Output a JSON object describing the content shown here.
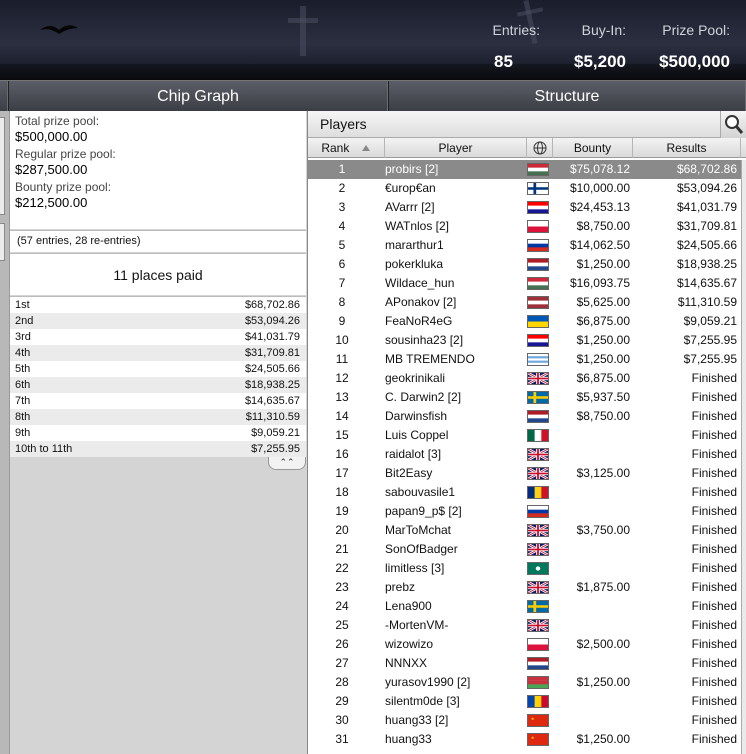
{
  "header": {
    "entries_label": "Entries:",
    "entries_value": "85",
    "buyin_label": "Buy-In:",
    "buyin_value": "$5,200",
    "prizepool_label": "Prize Pool:",
    "prizepool_value": "$500,000"
  },
  "tabs": [
    {
      "label": "Chip Graph"
    },
    {
      "label": "Structure"
    }
  ],
  "prize_info": {
    "total_label": "Total prize pool:",
    "total_value": "$500,000.00",
    "regular_label": "Regular prize pool:",
    "regular_value": "$287,500.00",
    "bounty_label": "Bounty prize pool:",
    "bounty_value": "$212,500.00",
    "entries_note": "(57 entries, 28 re-entries)",
    "places_paid": "11 places paid"
  },
  "payouts": [
    {
      "place": "1st",
      "amount": "$68,702.86"
    },
    {
      "place": "2nd",
      "amount": "$53,094.26"
    },
    {
      "place": "3rd",
      "amount": "$41,031.79"
    },
    {
      "place": "4th",
      "amount": "$31,709.81"
    },
    {
      "place": "5th",
      "amount": "$24,505.66"
    },
    {
      "place": "6th",
      "amount": "$18,938.25"
    },
    {
      "place": "7th",
      "amount": "$14,635.67"
    },
    {
      "place": "8th",
      "amount": "$11,310.59"
    },
    {
      "place": "9th",
      "amount": "$9,059.21"
    },
    {
      "place": "10th to 11th",
      "amount": "$7,255.95"
    }
  ],
  "players_panel": {
    "title": "Players",
    "columns": {
      "rank": "Rank",
      "player": "Player",
      "bounty": "Bounty",
      "results": "Results"
    },
    "selected_row": 0,
    "rows": [
      {
        "rank": "1",
        "name": "probirs [2]",
        "flag": "hungary",
        "bounty": "$75,078.12",
        "result": "$68,702.86"
      },
      {
        "rank": "2",
        "name": "€urop€an",
        "flag": "finland",
        "bounty": "$10,000.00",
        "result": "$53,094.26"
      },
      {
        "rank": "3",
        "name": "AVarrr [2]",
        "flag": "croatia",
        "bounty": "$24,453.13",
        "result": "$41,031.79"
      },
      {
        "rank": "4",
        "name": "WATnlos [2]",
        "flag": "poland",
        "bounty": "$8,750.00",
        "result": "$31,709.81"
      },
      {
        "rank": "5",
        "name": "mararthur1",
        "flag": "russia",
        "bounty": "$14,062.50",
        "result": "$24,505.66"
      },
      {
        "rank": "6",
        "name": "pokerkluka",
        "flag": "netherlands",
        "bounty": "$1,250.00",
        "result": "$18,938.25"
      },
      {
        "rank": "7",
        "name": "Wildace_hun",
        "flag": "hungary",
        "bounty": "$16,093.75",
        "result": "$14,635.67"
      },
      {
        "rank": "8",
        "name": "APonakov [2]",
        "flag": "latvia",
        "bounty": "$5,625.00",
        "result": "$11,310.59"
      },
      {
        "rank": "9",
        "name": "FeaNoR4eG",
        "flag": "ukraine",
        "bounty": "$6,875.00",
        "result": "$9,059.21"
      },
      {
        "rank": "10",
        "name": "sousinha23 [2]",
        "flag": "croatia",
        "bounty": "$1,250.00",
        "result": "$7,255.95"
      },
      {
        "rank": "11",
        "name": "MB TREMENDO",
        "flag": "uruguay",
        "bounty": "$1,250.00",
        "result": "$7,255.95"
      },
      {
        "rank": "12",
        "name": "geokrinikali",
        "flag": "uk",
        "bounty": "$6,875.00",
        "result": "Finished"
      },
      {
        "rank": "13",
        "name": "C. Darwin2 [2]",
        "flag": "sweden",
        "bounty": "$5,937.50",
        "result": "Finished"
      },
      {
        "rank": "14",
        "name": "Darwinsfish",
        "flag": "netherlands",
        "bounty": "$8,750.00",
        "result": "Finished"
      },
      {
        "rank": "15",
        "name": "Luis Coppel",
        "flag": "mexico",
        "bounty": "",
        "result": "Finished"
      },
      {
        "rank": "16",
        "name": "raidalot [3]",
        "flag": "uk",
        "bounty": "",
        "result": "Finished"
      },
      {
        "rank": "17",
        "name": "Bit2Easy",
        "flag": "uk",
        "bounty": "$3,125.00",
        "result": "Finished"
      },
      {
        "rank": "18",
        "name": "sabouvasile1",
        "flag": "romania",
        "bounty": "",
        "result": "Finished"
      },
      {
        "rank": "19",
        "name": "papan9_p$ [2]",
        "flag": "russia",
        "bounty": "",
        "result": "Finished"
      },
      {
        "rank": "20",
        "name": "MarToMchat",
        "flag": "uk",
        "bounty": "$3,750.00",
        "result": "Finished"
      },
      {
        "rank": "21",
        "name": "SonOfBadger",
        "flag": "uk",
        "bounty": "",
        "result": "Finished"
      },
      {
        "rank": "22",
        "name": "limitless [3]",
        "flag": "macau",
        "bounty": "",
        "result": "Finished"
      },
      {
        "rank": "23",
        "name": "prebz",
        "flag": "uk",
        "bounty": "$1,875.00",
        "result": "Finished"
      },
      {
        "rank": "24",
        "name": "Lena900",
        "flag": "sweden",
        "bounty": "",
        "result": "Finished"
      },
      {
        "rank": "25",
        "name": "-MortenVM-",
        "flag": "uk",
        "bounty": "",
        "result": "Finished"
      },
      {
        "rank": "26",
        "name": "wizowizo",
        "flag": "poland",
        "bounty": "$2,500.00",
        "result": "Finished"
      },
      {
        "rank": "27",
        "name": "NNNXX",
        "flag": "netherlands",
        "bounty": "",
        "result": "Finished"
      },
      {
        "rank": "28",
        "name": "yurasov1990 [2]",
        "flag": "belarus",
        "bounty": "$1,250.00",
        "result": "Finished"
      },
      {
        "rank": "29",
        "name": "silentm0de [3]",
        "flag": "moldova",
        "bounty": "",
        "result": "Finished"
      },
      {
        "rank": "30",
        "name": "huang33 [2]",
        "flag": "china",
        "bounty": "",
        "result": "Finished"
      },
      {
        "rank": "31",
        "name": "huang33",
        "flag": "china",
        "bounty": "$1,250.00",
        "result": "Finished"
      }
    ]
  },
  "icons": {
    "zoom": "magnifier-icon",
    "globe": "globe-icon",
    "sort": "sort-up-icon",
    "collapse": "collapse-chevron-icon"
  }
}
